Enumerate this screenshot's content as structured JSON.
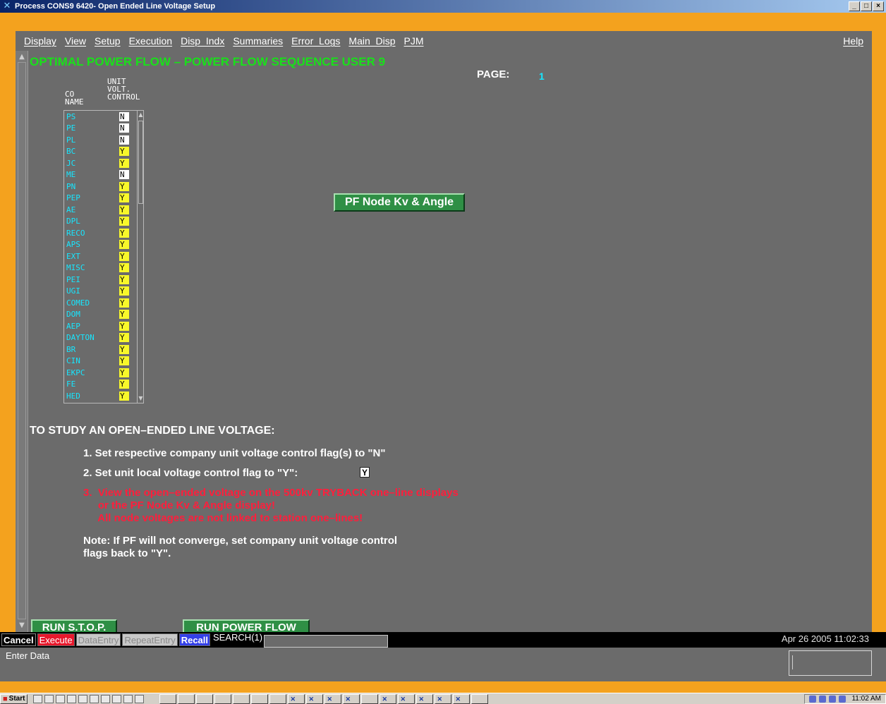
{
  "window": {
    "title": "Process CONS9 6420- Open Ended Line Voltage Setup",
    "controls": [
      "_",
      "□",
      "×"
    ]
  },
  "menu": {
    "items": [
      "Display",
      "View",
      "Setup",
      "Execution",
      "Disp_Indx",
      "Summaries",
      "Error_Logs",
      "Main_Disp",
      "PJM"
    ],
    "help": "Help"
  },
  "main": {
    "heading": "OPTIMAL POWER FLOW – POWER FLOW SEQUENCE USER  9",
    "page_label": "PAGE:",
    "page_number": "1",
    "col_co": [
      "CO",
      "NAME"
    ],
    "col_unit": [
      "UNIT",
      "VOLT.",
      "CONTROL"
    ],
    "companies": [
      {
        "name": "PS",
        "flag": "N"
      },
      {
        "name": "PE",
        "flag": "N"
      },
      {
        "name": "PL",
        "flag": "N"
      },
      {
        "name": "BC",
        "flag": "Y"
      },
      {
        "name": "JC",
        "flag": "Y"
      },
      {
        "name": "ME",
        "flag": "N"
      },
      {
        "name": "PN",
        "flag": "Y"
      },
      {
        "name": "PEP",
        "flag": "Y"
      },
      {
        "name": "AE",
        "flag": "Y"
      },
      {
        "name": "DPL",
        "flag": "Y"
      },
      {
        "name": "RECO",
        "flag": "Y"
      },
      {
        "name": "APS",
        "flag": "Y"
      },
      {
        "name": "EXT",
        "flag": "Y"
      },
      {
        "name": "MISC",
        "flag": "Y"
      },
      {
        "name": "PEI",
        "flag": "Y"
      },
      {
        "name": "UGI",
        "flag": "Y"
      },
      {
        "name": "COMED",
        "flag": "Y"
      },
      {
        "name": "DOM",
        "flag": "Y"
      },
      {
        "name": "AEP",
        "flag": "Y"
      },
      {
        "name": "DAYTON",
        "flag": "Y"
      },
      {
        "name": "BR",
        "flag": "Y"
      },
      {
        "name": "CIN",
        "flag": "Y"
      },
      {
        "name": "EKPC",
        "flag": "Y"
      },
      {
        "name": "FE",
        "flag": "Y"
      },
      {
        "name": "HED",
        "flag": "Y"
      }
    ],
    "pf_node_button": "PF Node Kv & Angle",
    "instructions_title": "TO STUDY AN OPEN–ENDED LINE VOLTAGE:",
    "step1": "1.  Set respective company unit voltage control flag(s) to \"N\"",
    "step2": "2.  Set unit local voltage control flag to \"Y\":",
    "step2_value": "Y",
    "step3_lines": [
      "3.  View the open–ended voltage on the 500kv TRYBACK one–line displays",
      "     or the PF Node Kv & Angle display!",
      "     All node voltages are not linked to station one–lines!"
    ],
    "note_lines": [
      "Note:  If PF will not converge, set company unit voltage control",
      "flags back to \"Y\"."
    ],
    "run_stop": "RUN S.T.O.P.",
    "run_power_flow": "RUN POWER FLOW"
  },
  "cmdbar": {
    "cancel": "Cancel",
    "execute": "Execute",
    "dataentry": "DataEntry",
    "repeatentry": "RepeatEntry",
    "recall": "Recall",
    "search": "SEARCH(1)",
    "datetime": "Apr 26 2005 11:02:33"
  },
  "message": {
    "prompt": "Enter Data"
  },
  "taskbar": {
    "start": "Start",
    "clock": "11:02 AM"
  },
  "colors": {
    "panel": "#6b6b6b",
    "frame": "#f4a21e",
    "heading": "#19e01a",
    "company": "#17e6ff",
    "flag_yes": "#f8f82a",
    "warning": "#ff1e3c",
    "button_green": "#2f8f45"
  }
}
